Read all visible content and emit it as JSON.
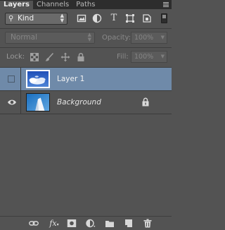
{
  "tabs": [
    {
      "label": "Layers",
      "active": true
    },
    {
      "label": "Channels",
      "active": false
    },
    {
      "label": "Paths",
      "active": false
    }
  ],
  "filter": {
    "kind_label": "Kind",
    "icons": [
      "pixel-layer-filter-icon",
      "adjustment-layer-filter-icon",
      "type-layer-filter-icon",
      "shape-layer-filter-icon",
      "smart-object-filter-icon"
    ]
  },
  "blend": {
    "mode": "Normal",
    "opacity_label": "Opacity:",
    "opacity_value": "100%"
  },
  "lock": {
    "label": "Lock:",
    "icons": [
      "lock-transparent-pixels-icon",
      "lock-image-pixels-icon",
      "lock-position-icon",
      "lock-all-icon"
    ],
    "fill_label": "Fill:",
    "fill_value": "100%"
  },
  "layers": [
    {
      "name": "Layer 1",
      "selected": true,
      "visible": false,
      "locked": false
    },
    {
      "name": "Background",
      "selected": false,
      "visible": true,
      "locked": true
    }
  ],
  "bottom_icons": [
    "link-layers-icon",
    "fx-icon",
    "layer-mask-icon",
    "adjustment-layer-icon",
    "new-group-icon",
    "new-layer-icon",
    "delete-layer-icon"
  ],
  "bottom_fx_label": "fx",
  "colors": {
    "panel_bg": "#535353",
    "tab_bar_bg": "#2d2d2d",
    "selection": "#6f8aa9"
  }
}
